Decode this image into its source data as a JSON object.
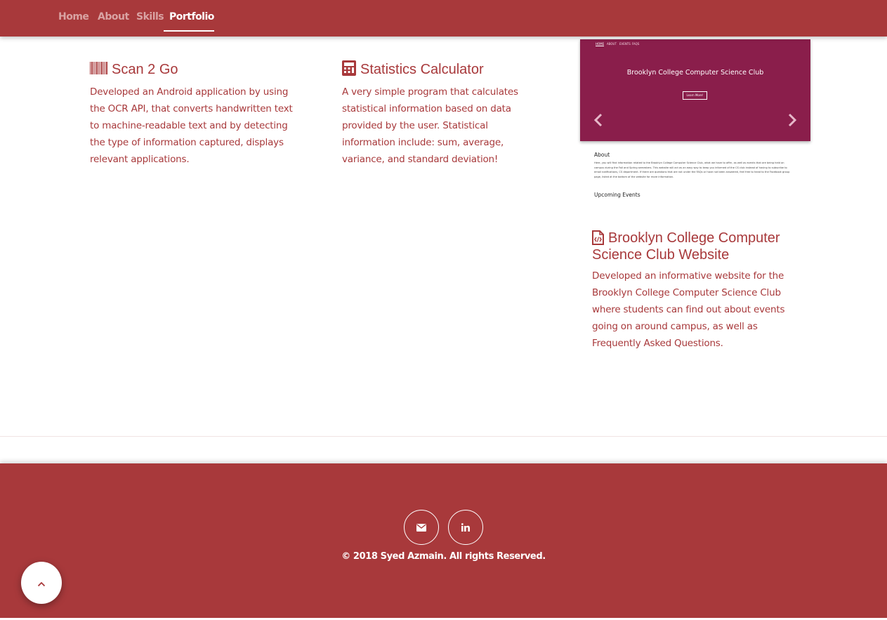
{
  "nav": {
    "items": [
      {
        "label": "Home"
      },
      {
        "label": "About"
      },
      {
        "label": "Skills"
      },
      {
        "label": "Portfolio"
      }
    ]
  },
  "projects": [
    {
      "title": "Scan 2 Go",
      "icon": "barcode-icon",
      "description": "Developed an Android application by using the OCR API, that converts handwritten text to machine-readable text and by detecting the type of information captured, displays relevant applications."
    },
    {
      "title": "Statistics Calculator",
      "icon": "calculator-icon",
      "description": "A very simple program that calculates statistical information based on data provided by the user. Statistical information include: sum, average, variance, and standard deviation!"
    },
    {
      "title": "Brooklyn College Computer Science Club Website",
      "icon": "file-code-icon",
      "description": "Developed an informative website for the Brooklyn College Computer Science Club where students can find out about events going on around campus, as well as Frequently Asked Questions."
    }
  ],
  "preview": {
    "nav": [
      "HOME",
      "ABOUT",
      "EVENTS",
      "FAQS"
    ],
    "title": "Brooklyn College Computer Science Club",
    "button": "Learn More!",
    "about_heading": "About",
    "about_text": "Here, you will find information related to the Brooklyn College Computer Science Club, what we have to offer, as well as events that are being held on campus during the Fall and Spring semesters. This website will act as an easy way to keep you informed of the CS club instead of having to subscribe to email notifications, CS department. If there are questions that are not under the FAQs or have not been answered, feel free to head to the Facebook group page, listed at the bottom of the website for more information.",
    "events_heading": "Upcoming Events"
  },
  "footer": {
    "copyright": "© 2018 Syed Azmain. All rights Reserved.",
    "social": [
      "envelope-icon",
      "linkedin-icon"
    ]
  },
  "colors": {
    "brand": "#a8393b",
    "preview_banner": "#8a1e4b"
  }
}
